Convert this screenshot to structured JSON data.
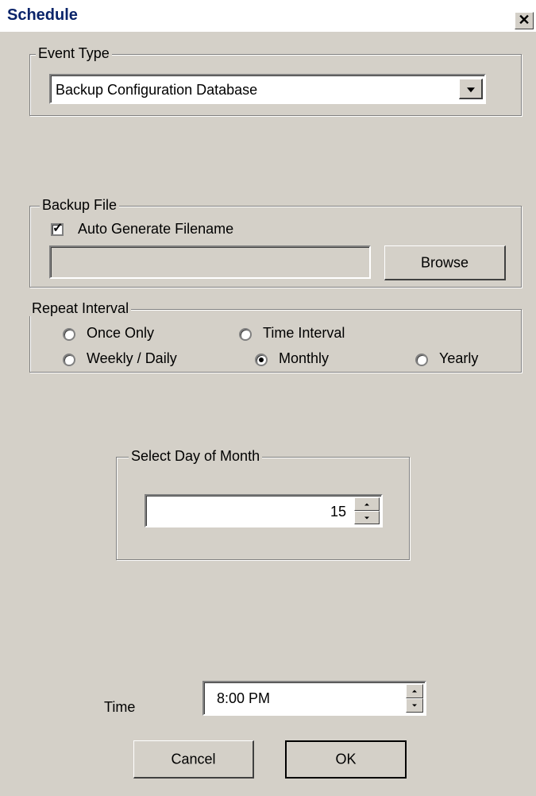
{
  "window": {
    "title": "Schedule",
    "close_glyph": "✕"
  },
  "event_type": {
    "legend": "Event Type",
    "selected": "Backup Configuration Database"
  },
  "backup_file": {
    "legend": "Backup File",
    "auto_generate_label": "Auto Generate Filename",
    "auto_generate_checked": true,
    "filename_value": "",
    "browse_label": "Browse"
  },
  "repeat_interval": {
    "legend": "Repeat Interval",
    "options": [
      {
        "label": "Once Only",
        "selected": false
      },
      {
        "label": "Time Interval",
        "selected": false
      },
      {
        "label": "Weekly / Daily",
        "selected": false
      },
      {
        "label": "Monthly",
        "selected": true
      },
      {
        "label": "Yearly",
        "selected": false
      }
    ]
  },
  "day_of_month": {
    "legend": "Select Day of Month",
    "value": "15"
  },
  "time": {
    "label": "Time",
    "value": "8:00 PM"
  },
  "buttons": {
    "cancel_label": "Cancel",
    "ok_label": "OK"
  },
  "icons": {
    "close": "close-icon",
    "dropdown": "chevron-down-icon",
    "spin_up": "spin-up-icon",
    "spin_down": "spin-down-icon"
  }
}
